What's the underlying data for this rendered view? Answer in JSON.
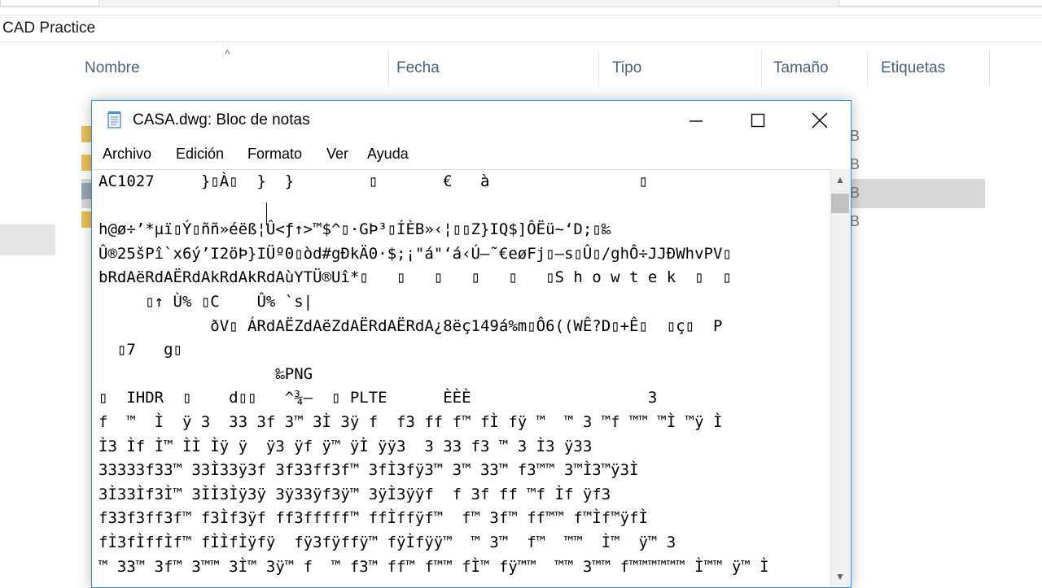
{
  "explorer": {
    "folder_name": "CAD Practice",
    "columns": [
      "Nombre",
      "Fecha",
      "Tipo",
      "Tamaño",
      "Etiquetas"
    ],
    "sort_indicator": "^",
    "size_fragments": [
      "B",
      "B",
      "B",
      "B"
    ]
  },
  "notepad": {
    "title": "CASA.dwg: Bloc de notas",
    "menu": [
      "Archivo",
      "Edición",
      "Formato",
      "Ver",
      "Ayuda"
    ],
    "lines": [
      "AC1027     }▯À▯  }  }        ▯       €   à                ▯",
      "",
      "h@ø÷’*µï▯Ý▯ññ»éëß¦Û<ƒ↑>™$^▯·GÞ³▯ÍÈB»‹¦▯▯Z}IQ$]ÔËü~‘D;▯‰",
      "Û®25šPî`x6ý’I2öÞ}IÜº0▯òd#gÐkÄ0·$;¡\"á\"‘á‹Ú–˜€eøFj▯–s▯Û▯/ghÔ÷JJÐWhvPV▯",
      "bRdAëRdAËRdAkRdAkRdAùYTÜ®Uî*▯   ▯   ▯   ▯   ▯   ▯S h o w t e k  ▯  ▯",
      "     ▯↑ Ù% ▯C    Û% `s|",
      "            ðV▯ ÁRdAËZdAëZdAËRdAËRdA¿8ëç149á%m▯Ô6((WÊ?D▯+Ê▯  ▯ç▯  P",
      "  ▯7   g▯",
      "                   ‰PNG",
      "▯  IHDR  ▯    d▯▯   ^¾–  ▯ PLTE      ÈÈÈ                   3",
      "f  ™  Ì  ÿ 3  33 3f 3™ 3Ì 3ÿ f  f3 ff f™ fÌ fÿ ™  ™ 3 ™f ™™ ™Ì ™ÿ Ì",
      "Ì3 Ìf Ì™ ÌÌ Ìÿ ÿ  ÿ3 ÿf ÿ™ ÿÌ ÿÿ3  3 33 f3 ™ 3 Ì3 ÿ33",
      "33333f33™ 33Ì33ÿ3f 3f33ff3f™ 3fÌ3fÿ3™ 3™ 33™ f3™™ 3™Ì3™ÿ3Ì",
      "3Ì33Ìf3Ì™ 3ÌÌ3Ìÿ3ÿ 3ÿ33ÿf3ÿ™ 3ÿÌ3ÿÿf  f 3f ff ™f Ìf ÿf3",
      "f33f3ff3f™ f3Ìf3ÿf ff3fffff™ ffÌffÿf™  f™ 3f™ ff™™ f™Ìf™ÿfÌ",
      "fÌ3fÌffÌf™ fÌÌfÌÿfÿ  fÿ3fÿffÿ™ fÿÌfÿÿ™  ™ 3™  f™  ™™  Ì™  ÿ™ 3",
      "™ 33™ 3f™ 3™™ 3Ì™ 3ÿ™ f  ™ f3™ ff™ f™™ fÌ™ fÿ™™  ™™ 3™™ f™™™™™™ Ì™™ ÿ™ Ì"
    ]
  }
}
